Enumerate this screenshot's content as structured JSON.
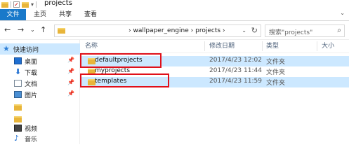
{
  "window": {
    "title": "projects"
  },
  "ribbon": {
    "tabs": [
      "文件",
      "主页",
      "共享",
      "查看"
    ]
  },
  "address": {
    "path": [
      "wallpaper_engine",
      "projects"
    ],
    "separator": "›"
  },
  "search": {
    "placeholder": "搜索\"projects\""
  },
  "sidebar": {
    "items": [
      {
        "label": "快速访问",
        "icon": "star-icon"
      },
      {
        "label": "桌面",
        "icon": "desktop-icon",
        "pinned": true
      },
      {
        "label": "下载",
        "icon": "download-icon",
        "pinned": true
      },
      {
        "label": "文档",
        "icon": "documents-icon",
        "pinned": true
      },
      {
        "label": "图片",
        "icon": "pictures-icon",
        "pinned": true
      },
      {
        "label": "",
        "icon": "folder-icon"
      },
      {
        "label": "",
        "icon": "folder-icon"
      },
      {
        "label": "视频",
        "icon": "video-icon"
      },
      {
        "label": "音乐",
        "icon": "music-icon"
      }
    ]
  },
  "columns": {
    "name": "名称",
    "date": "修改日期",
    "type": "类型",
    "size": "大小"
  },
  "files": [
    {
      "name": "defaultprojects",
      "date": "2017/4/23 12:02",
      "type": "文件夹",
      "selected": true,
      "annotated": true
    },
    {
      "name": "myprojects",
      "date": "2017/4/23 11:44",
      "type": "文件夹",
      "selected": false,
      "annotated": false
    },
    {
      "name": "templates",
      "date": "2017/4/23 11:59",
      "type": "文件夹",
      "selected": true,
      "annotated": true
    }
  ],
  "colors": {
    "accent": "#1979ca",
    "selection": "#cce8ff",
    "annotation": "#e0101a",
    "folder": "#e8b53a"
  }
}
